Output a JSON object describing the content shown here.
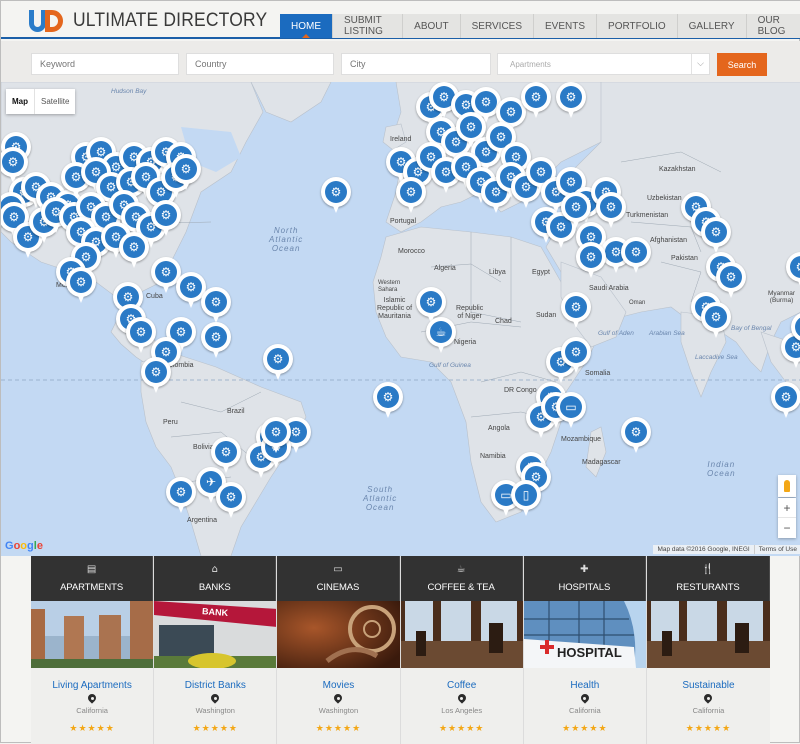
{
  "header": {
    "logo_text": "ULTIMATE DIRECTORY",
    "nav": [
      {
        "label": "HOME",
        "active": true
      },
      {
        "label": "SUBMIT LISTING",
        "active": false
      },
      {
        "label": "ABOUT",
        "active": false
      },
      {
        "label": "SERVICES",
        "active": false
      },
      {
        "label": "EVENTS",
        "active": false
      },
      {
        "label": "PORTFOLIO",
        "active": false
      },
      {
        "label": "GALLERY",
        "active": false
      },
      {
        "label": "OUR BLOG",
        "active": false
      }
    ]
  },
  "search": {
    "keyword_placeholder": "Keyword",
    "country_placeholder": "Country",
    "city_placeholder": "City",
    "category_selected": "Apartments",
    "button_label": "Search"
  },
  "map": {
    "type_controls": {
      "map": "Map",
      "satellite": "Satellite"
    },
    "labels": {
      "hudson_bay": "Hudson Bay",
      "north_atlantic": "North\nAtlantic\nOcean",
      "south_atlantic": "South\nAtlantic\nOcean",
      "indian_ocean": "Indian\nOcean",
      "ireland": "Ireland",
      "portugal": "Portugal",
      "morocco": "Morocco",
      "algeria": "Algeria",
      "libya": "Libya",
      "egypt": "Egypt",
      "western_sahara": "Western\nSahara",
      "mauritania": "Islamic\nRepublic of\nMauritania",
      "niger": "Republic\nof Niger",
      "chad": "Chad",
      "sudan": "Sudan",
      "nigeria": "Nigeria",
      "gulf_guinea": "Gulf of Guinea",
      "dr_congo": "DR Congo",
      "angola": "Angola",
      "namibia": "Namibia",
      "mozambique": "Mozambique",
      "madagascar": "Madagascar",
      "kazakhstan": "Kazakhstan",
      "uzbekistan": "Uzbekistan",
      "turkmenistan": "Turkmenistan",
      "afghanistan": "Afghanistan",
      "pakistan": "Pakistan",
      "saudi_arabia": "Saudi Arabia",
      "oman": "Oman",
      "arabian_sea": "Arabian Sea",
      "gulf_aden": "Gulf of Aden",
      "bay_bengal": "Bay of Bengal",
      "laccadive": "Laccadive Sea",
      "myanmar": "Myanmar\n(Burma)",
      "somalia": "Somalia",
      "brazil": "Brazil",
      "peru": "Peru",
      "bolivia": "Bolivia",
      "argentina": "Argentina",
      "cuba": "Cuba",
      "colombia": "Colombia",
      "mexico": "Mexico"
    },
    "google_logo": "Google",
    "attribution": "Map data ©2016 Google, INEGI",
    "terms": "Terms of Use",
    "zoom_in": "+",
    "zoom_out": "−"
  },
  "categories": [
    {
      "label": "APARTMENTS",
      "icon": "building-icon",
      "glyph": "▤",
      "title": "Living Apartments",
      "location": "California",
      "rating": 5
    },
    {
      "label": "BANKS",
      "icon": "bank-icon",
      "glyph": "⌂",
      "title": "District Banks",
      "location": "Washington",
      "rating": 5
    },
    {
      "label": "CINEMAS",
      "icon": "monitor-icon",
      "glyph": "▭",
      "title": "Movies",
      "location": "Washington",
      "rating": 5
    },
    {
      "label": "COFFEE & TEA",
      "icon": "coffee-cup-icon",
      "glyph": "☕",
      "title": "Coffee",
      "location": "Los Angeles",
      "rating": 5
    },
    {
      "label": "HOSPITALS",
      "icon": "ambulance-icon",
      "glyph": "✚",
      "title": "Health",
      "location": "California",
      "rating": 5
    },
    {
      "label": "RESTURANTS",
      "icon": "cutlery-icon",
      "glyph": "🍴",
      "title": "Sustainable",
      "location": "California",
      "rating": 5
    }
  ],
  "colors": {
    "brand_blue": "#1b6bbf",
    "brand_orange": "#e4661d",
    "pin_blue": "#2a7ac6",
    "star": "#f3a716"
  }
}
